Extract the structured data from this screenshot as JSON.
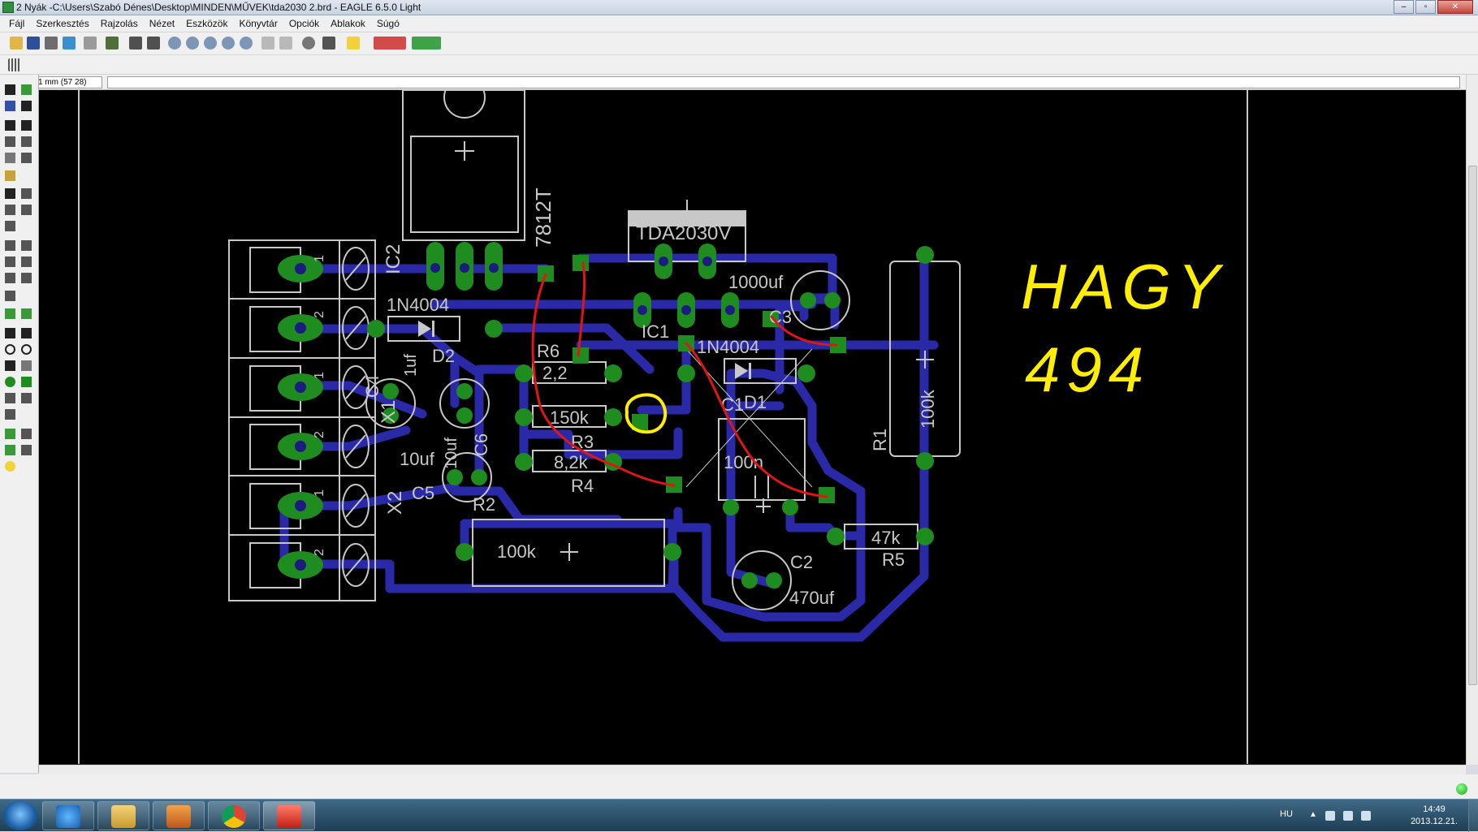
{
  "window": {
    "title": "2 Nyák -C:\\Users\\Szabó Dénes\\Desktop\\MINDEN\\MŰVEK\\tda2030 2.brd - EAGLE 6.5.0 Light",
    "min_label": "–",
    "max_label": "▫",
    "close_label": "✕"
  },
  "menu": [
    "Fájl",
    "Szerkesztés",
    "Rajzolás",
    "Nézet",
    "Eszközök",
    "Könyvtár",
    "Opciók",
    "Ablakok",
    "Súgó"
  ],
  "coord_display": "1 mm (57 28)",
  "colors": {
    "board_background": "#000000",
    "trace": "#2a2aa8",
    "pad": "#1f8c1f",
    "pad_hole": "#1c1c80",
    "silkscreen": "#c8c8c8",
    "annotation_red": "#e01515",
    "annotation_yellow": "#ffee00"
  },
  "board": {
    "labels": {
      "ic2_part": "7812T",
      "ic2_name": "IC2",
      "ic1_part": "TDA2030V",
      "ic1_name": "IC1",
      "d2_part": "1N4004",
      "d2_name": "D2",
      "d1_part": "1N4004",
      "d1_name": "D1",
      "r6_name": "R6",
      "r6_value": "2,2",
      "r3_value": "150k",
      "r3_name": "R3",
      "r4_value": "8,2k",
      "r4_name": "R4",
      "r2_name": "R2",
      "r2_value": "100k",
      "r1_name": "R1",
      "r1_value": "100k",
      "r5_value": "47k",
      "r5_name": "R5",
      "c1_name": "C1",
      "c1_value": "100n",
      "c2_name": "C2",
      "c2_value": "470uf",
      "c3_name": "C3",
      "c3_value": "1000uf",
      "c4_name": "C4",
      "c4_value": "1uf",
      "c5_name": "C5",
      "c5_value": "10uf",
      "c6_name": "C6",
      "c6_value": "10uf",
      "x1_name": "X1",
      "x2_name": "X2",
      "pin1": "1",
      "pin2": "2"
    },
    "handwriting": {
      "line1": "HAGY",
      "line2": "494"
    }
  },
  "taskbar": {
    "apps": [
      "internet-explorer",
      "file-explorer",
      "media-player",
      "chrome",
      "eagle"
    ],
    "tray": {
      "lang": "HU",
      "time": "14:49",
      "date": "2013.12.21."
    }
  }
}
